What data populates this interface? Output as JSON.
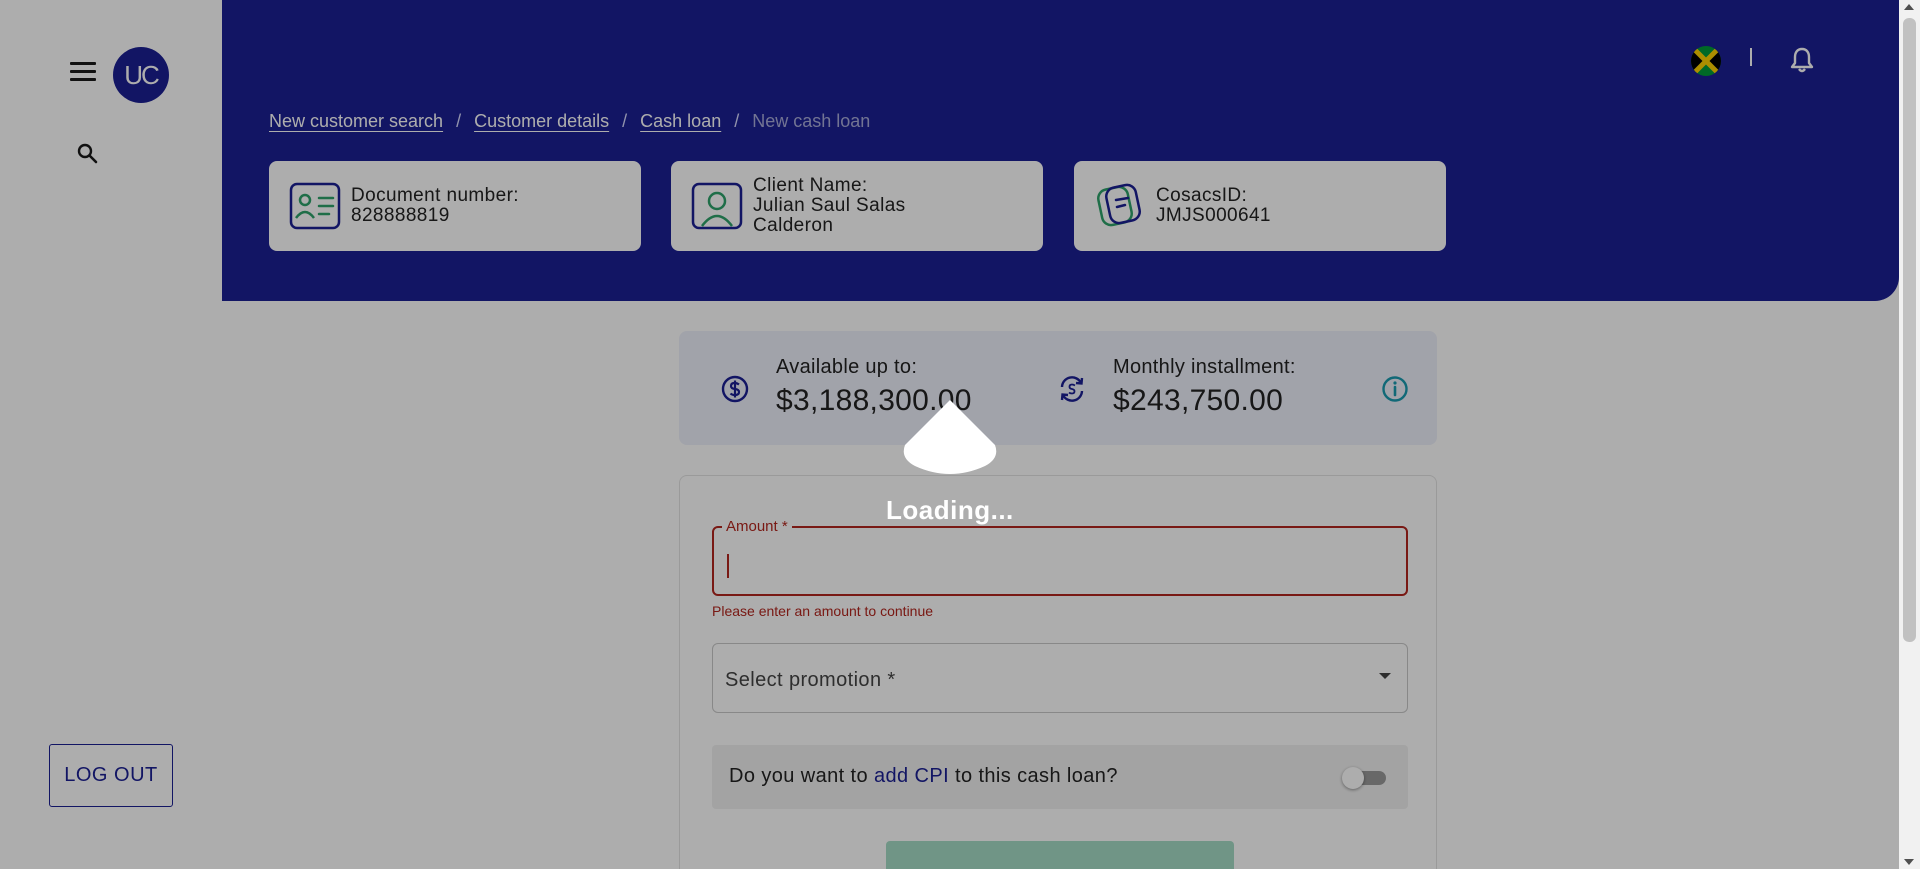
{
  "sidebar": {
    "avatar_text": "UC",
    "menu_icon": "hamburger-menu-icon",
    "search_icon": "search-icon",
    "logout_label": "LOG OUT"
  },
  "header": {
    "flag_icon": "jamaica-flag-icon",
    "separator": "|",
    "bell_icon": "bell-icon",
    "breadcrumb": [
      {
        "label": "New customer search"
      },
      {
        "label": "Customer details"
      },
      {
        "label": "Cash loan"
      },
      {
        "label": "New cash loan"
      }
    ],
    "cards": [
      {
        "icon": "id-card-icon",
        "label": "Document number:",
        "value": "828888819"
      },
      {
        "icon": "user-icon",
        "label": "Client Name:",
        "value": "Julian Saul Salas Calderon"
      },
      {
        "icon": "cosacs-id-icon",
        "label": "CosacsID:",
        "value": "JMJS000641"
      }
    ]
  },
  "summary": {
    "available_label": "Available up to:",
    "available_value": "$3,188,300.00",
    "monthly_label": "Monthly installment:",
    "monthly_value": "$243,750.00"
  },
  "form": {
    "amount_label": "Amount *",
    "amount_value": "",
    "amount_error": "Please enter an amount to continue",
    "promotion_placeholder": "Select promotion *",
    "cpi_prefix": "Do you want to ",
    "cpi_highlight": "add CPI",
    "cpi_suffix": " to this cash loan?",
    "cpi_enabled": false
  },
  "overlay": {
    "loading_text": "Loading..."
  },
  "colors": {
    "brand_blue": "#1b1f94",
    "error_red": "#b3261e",
    "accent_green": "#2fa36b",
    "info_teal": "#1a9bb0"
  }
}
